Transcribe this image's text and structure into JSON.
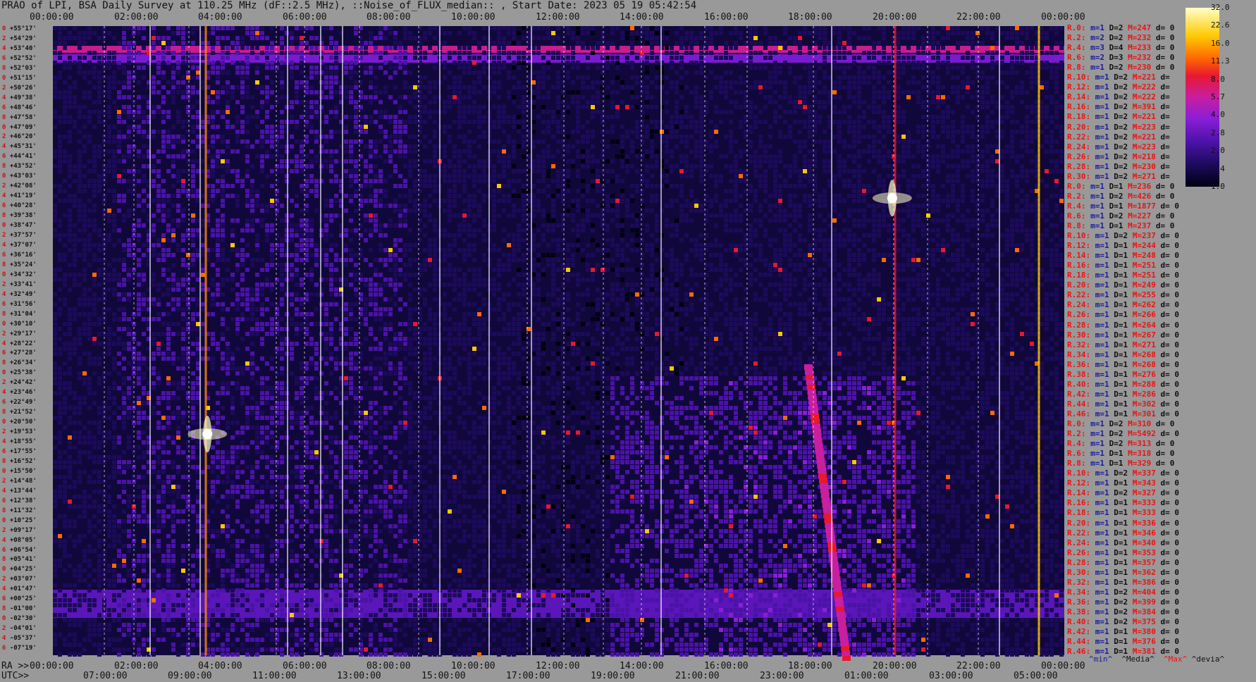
{
  "title": "PRAO of LPI, BSA Daily Survey at 110.25 MHz (dF::2.5 MHz), ::Noise_of_FLUX_median:: , Start Date: 2023 05 19 05:42:54",
  "chart_data": {
    "type": "heatmap",
    "title": "PRAO of LPI, BSA Daily Survey at 110.25 MHz (dF::2.5 MHz), ::Noise_of_FLUX_median:: , Start Date: 2023 05 19 05:42:54",
    "x_top_ticks": [
      "00:00:00",
      "02:00:00",
      "04:00:00",
      "06:00:00",
      "08:00:00",
      "10:00:00",
      "12:00:00",
      "14:00:00",
      "16:00:00",
      "18:00:00",
      "20:00:00",
      "22:00:00",
      "00:00:00"
    ],
    "x_ra_label": "RA >>",
    "x_ra_ticks": [
      "00:00:00",
      "02:00:00",
      "04:00:00",
      "06:00:00",
      "08:00:00",
      "10:00:00",
      "12:00:00",
      "14:00:00",
      "16:00:00",
      "18:00:00",
      "20:00:00",
      "22:00:00",
      "00:00:00"
    ],
    "x_utc_label": "UTC>>",
    "x_utc_ticks": [
      "07:00:00",
      "09:00:00",
      "11:00:00",
      "13:00:00",
      "15:00:00",
      "17:00:00",
      "19:00:00",
      "21:00:00",
      "23:00:00",
      "01:00:00",
      "03:00:00",
      "05:00:00"
    ],
    "y_dec_labels": [
      "+55°17'",
      "+54°29'",
      "+53°40'",
      "+52°52'",
      "+52°03'",
      "+51°15'",
      "+50°26'",
      "+49°38'",
      "+48°46'",
      "+47°58'",
      "+47°09'",
      "+46°20'",
      "+45°31'",
      "+44°41'",
      "+43°52'",
      "+43°03'",
      "+42°08'",
      "+41°19'",
      "+40°28'",
      "+39°38'",
      "+38°47'",
      "+37°57'",
      "+37°07'",
      "+36°16'",
      "+35°24'",
      "+34°32'",
      "+33°41'",
      "+32°49'",
      "+31°56'",
      "+31°04'",
      "+30°10'",
      "+29°17'",
      "+28°22'",
      "+27°28'",
      "+26°34'",
      "+25°38'",
      "+24°42'",
      "+23°46'",
      "+22°49'",
      "+21°52'",
      "+20°50'",
      "+19°53'",
      "+18°55'",
      "+17°55'",
      "+16°52'",
      "+15°50'",
      "+14°48'",
      "+13°44'",
      "+12°38'",
      "+11°32'",
      "+10°25'",
      "+09°17'",
      "+08°05'",
      "+06°54'",
      "+05°41'",
      "+04°25'",
      "+03°07'",
      "+01°47'",
      "+00°25'",
      "-01°00'",
      "-02°30'",
      "-04°01'",
      "-05°37'",
      "-07°19'"
    ],
    "y_dec_index": [
      "0",
      "2",
      "4",
      "6",
      "8",
      "0",
      "2",
      "4",
      "6",
      "8",
      "0",
      "2",
      "4",
      "6",
      "8",
      "0",
      "2",
      "4",
      "6",
      "8",
      "0",
      "2",
      "4",
      "6",
      "8",
      "0",
      "2",
      "4",
      "6",
      "8",
      "0",
      "2",
      "4",
      "6",
      "8",
      "0",
      "2",
      "4",
      "6",
      "8",
      "0",
      "2",
      "4",
      "6",
      "8",
      "0",
      "2",
      "4",
      "6",
      "8",
      "0",
      "2",
      "4",
      "6",
      "8",
      "0",
      "2",
      "4",
      "6",
      "8",
      "0",
      "2",
      "4",
      "6"
    ],
    "colorbar_ticks": [
      "32.0",
      "22.6",
      "16.0",
      "11.3",
      "8.0",
      "5.7",
      "4.0",
      "2.8",
      "2.0",
      "1.4",
      "1.0"
    ],
    "colorbar_scale": "log",
    "colormap": [
      "#000010",
      "#1c0a5a",
      "#4b12a8",
      "#8a1ed8",
      "#c81ea0",
      "#e81830",
      "#ff6a00",
      "#ffc800",
      "#ffffc8"
    ],
    "bright_sources": [
      {
        "ra": "03:40",
        "dec": "+19°53'",
        "label": ""
      },
      {
        "ra": "19:55",
        "dec": "+41°19'",
        "label": ""
      }
    ]
  },
  "stats": [
    {
      "r": "R.0:",
      "m": "m=1",
      "d": "D=2",
      "M": "M=247",
      "dv": "d= 0"
    },
    {
      "r": "R.2:",
      "m": "m=2",
      "d": "D=2",
      "M": "M=232",
      "dv": "d= 0"
    },
    {
      "r": "R.4:",
      "m": "m=3",
      "d": "D=4",
      "M": "M=233",
      "dv": "d= 0"
    },
    {
      "r": "R.6:",
      "m": "m=2",
      "d": "D=3",
      "M": "M=232",
      "dv": "d= 0"
    },
    {
      "r": "R.8:",
      "m": "m=1",
      "d": "D=2",
      "M": "M=230",
      "dv": "d= 0"
    },
    {
      "r": "R.10:",
      "m": "m=1",
      "d": "D=2",
      "M": "M=221",
      "dv": "d="
    },
    {
      "r": "R.12:",
      "m": "m=1",
      "d": "D=2",
      "M": "M=222",
      "dv": "d="
    },
    {
      "r": "R.14:",
      "m": "m=1",
      "d": "D=2",
      "M": "M=222",
      "dv": "d="
    },
    {
      "r": "R.16:",
      "m": "m=1",
      "d": "D=2",
      "M": "M=391",
      "dv": "d="
    },
    {
      "r": "R.18:",
      "m": "m=1",
      "d": "D=2",
      "M": "M=221",
      "dv": "d="
    },
    {
      "r": "R.20:",
      "m": "m=1",
      "d": "D=2",
      "M": "M=223",
      "dv": "d="
    },
    {
      "r": "R.22:",
      "m": "m=1",
      "d": "D=2",
      "M": "M=221",
      "dv": "d="
    },
    {
      "r": "R.24:",
      "m": "m=1",
      "d": "D=2",
      "M": "M=223",
      "dv": "d="
    },
    {
      "r": "R.26:",
      "m": "m=1",
      "d": "D=2",
      "M": "M=218",
      "dv": "d="
    },
    {
      "r": "R.28:",
      "m": "m=1",
      "d": "D=2",
      "M": "M=230",
      "dv": "d="
    },
    {
      "r": "R.30:",
      "m": "m=1",
      "d": "D=2",
      "M": "M=271",
      "dv": "d="
    },
    {
      "r": "R.0:",
      "m": "m=1",
      "d": "D=1",
      "M": "M=236",
      "dv": "d= 0"
    },
    {
      "r": "R.2:",
      "m": "m=1",
      "d": "D=2",
      "M": "M=426",
      "dv": "d= 0"
    },
    {
      "r": "R.4:",
      "m": "m=1",
      "d": "D=1",
      "M": "M=1877",
      "dv": "d= 0"
    },
    {
      "r": "R.6:",
      "m": "m=1",
      "d": "D=2",
      "M": "M=227",
      "dv": "d= 0"
    },
    {
      "r": "R.8:",
      "m": "m=1",
      "d": "D=1",
      "M": "M=237",
      "dv": "d= 0"
    },
    {
      "r": "R.10:",
      "m": "m=1",
      "d": "D=2",
      "M": "M=237",
      "dv": "d= 0"
    },
    {
      "r": "R.12:",
      "m": "m=1",
      "d": "D=1",
      "M": "M=244",
      "dv": "d= 0"
    },
    {
      "r": "R.14:",
      "m": "m=1",
      "d": "D=1",
      "M": "M=248",
      "dv": "d= 0"
    },
    {
      "r": "R.16:",
      "m": "m=1",
      "d": "D=1",
      "M": "M=251",
      "dv": "d= 0"
    },
    {
      "r": "R.18:",
      "m": "m=1",
      "d": "D=1",
      "M": "M=251",
      "dv": "d= 0"
    },
    {
      "r": "R.20:",
      "m": "m=1",
      "d": "D=1",
      "M": "M=249",
      "dv": "d= 0"
    },
    {
      "r": "R.22:",
      "m": "m=1",
      "d": "D=1",
      "M": "M=255",
      "dv": "d= 0"
    },
    {
      "r": "R.24:",
      "m": "m=1",
      "d": "D=1",
      "M": "M=262",
      "dv": "d= 0"
    },
    {
      "r": "R.26:",
      "m": "m=1",
      "d": "D=1",
      "M": "M=266",
      "dv": "d= 0"
    },
    {
      "r": "R.28:",
      "m": "m=1",
      "d": "D=1",
      "M": "M=264",
      "dv": "d= 0"
    },
    {
      "r": "R.30:",
      "m": "m=1",
      "d": "D=1",
      "M": "M=267",
      "dv": "d= 0"
    },
    {
      "r": "R.32:",
      "m": "m=1",
      "d": "D=1",
      "M": "M=271",
      "dv": "d= 0"
    },
    {
      "r": "R.34:",
      "m": "m=1",
      "d": "D=1",
      "M": "M=268",
      "dv": "d= 0"
    },
    {
      "r": "R.36:",
      "m": "m=1",
      "d": "D=1",
      "M": "M=268",
      "dv": "d= 0"
    },
    {
      "r": "R.38:",
      "m": "m=1",
      "d": "D=1",
      "M": "M=276",
      "dv": "d= 0"
    },
    {
      "r": "R.40:",
      "m": "m=1",
      "d": "D=1",
      "M": "M=288",
      "dv": "d= 0"
    },
    {
      "r": "R.42:",
      "m": "m=1",
      "d": "D=1",
      "M": "M=286",
      "dv": "d= 0"
    },
    {
      "r": "R.44:",
      "m": "m=1",
      "d": "D=1",
      "M": "M=302",
      "dv": "d= 0"
    },
    {
      "r": "R.46:",
      "m": "m=1",
      "d": "D=1",
      "M": "M=301",
      "dv": "d= 0"
    },
    {
      "r": "R.0:",
      "m": "m=1",
      "d": "D=2",
      "M": "M=310",
      "dv": "d= 0"
    },
    {
      "r": "R.2:",
      "m": "m=1",
      "d": "D=2",
      "M": "M=5492",
      "dv": "d= 0"
    },
    {
      "r": "R.4:",
      "m": "m=1",
      "d": "D=2",
      "M": "M=313",
      "dv": "d= 0"
    },
    {
      "r": "R.6:",
      "m": "m=1",
      "d": "D=1",
      "M": "M=318",
      "dv": "d= 0"
    },
    {
      "r": "R.8:",
      "m": "m=1",
      "d": "D=1",
      "M": "M=329",
      "dv": "d= 0"
    },
    {
      "r": "R.10:",
      "m": "m=1",
      "d": "D=2",
      "M": "M=337",
      "dv": "d= 0"
    },
    {
      "r": "R.12:",
      "m": "m=1",
      "d": "D=1",
      "M": "M=343",
      "dv": "d= 0"
    },
    {
      "r": "R.14:",
      "m": "m=1",
      "d": "D=2",
      "M": "M=327",
      "dv": "d= 0"
    },
    {
      "r": "R.16:",
      "m": "m=1",
      "d": "D=1",
      "M": "M=333",
      "dv": "d= 0"
    },
    {
      "r": "R.18:",
      "m": "m=1",
      "d": "D=1",
      "M": "M=333",
      "dv": "d= 0"
    },
    {
      "r": "R.20:",
      "m": "m=1",
      "d": "D=1",
      "M": "M=336",
      "dv": "d= 0"
    },
    {
      "r": "R.22:",
      "m": "m=1",
      "d": "D=1",
      "M": "M=346",
      "dv": "d= 0"
    },
    {
      "r": "R.24:",
      "m": "m=1",
      "d": "D=1",
      "M": "M=340",
      "dv": "d= 0"
    },
    {
      "r": "R.26:",
      "m": "m=1",
      "d": "D=1",
      "M": "M=353",
      "dv": "d= 0"
    },
    {
      "r": "R.28:",
      "m": "m=1",
      "d": "D=1",
      "M": "M=357",
      "dv": "d= 0"
    },
    {
      "r": "R.30:",
      "m": "m=1",
      "d": "D=1",
      "M": "M=362",
      "dv": "d= 0"
    },
    {
      "r": "R.32:",
      "m": "m=1",
      "d": "D=1",
      "M": "M=386",
      "dv": "d= 0"
    },
    {
      "r": "R.34:",
      "m": "m=1",
      "d": "D=2",
      "M": "M=404",
      "dv": "d= 0"
    },
    {
      "r": "R.36:",
      "m": "m=1",
      "d": "D=2",
      "M": "M=399",
      "dv": "d= 0"
    },
    {
      "r": "R.38:",
      "m": "m=1",
      "d": "D=2",
      "M": "M=384",
      "dv": "d= 0"
    },
    {
      "r": "R.40:",
      "m": "m=1",
      "d": "D=2",
      "M": "M=375",
      "dv": "d= 0"
    },
    {
      "r": "R.42:",
      "m": "m=1",
      "d": "D=1",
      "M": "M=380",
      "dv": "d= 0"
    },
    {
      "r": "R.44:",
      "m": "m=1",
      "d": "D=1",
      "M": "M=376",
      "dv": "d= 0"
    },
    {
      "r": "R.46:",
      "m": "m=1",
      "d": "D=1",
      "M": "M=381",
      "dv": "d= 0"
    }
  ],
  "legend": {
    "min": "^min^",
    "median": "^Media^",
    "max": "^Max^",
    "devia": "^devia^"
  }
}
